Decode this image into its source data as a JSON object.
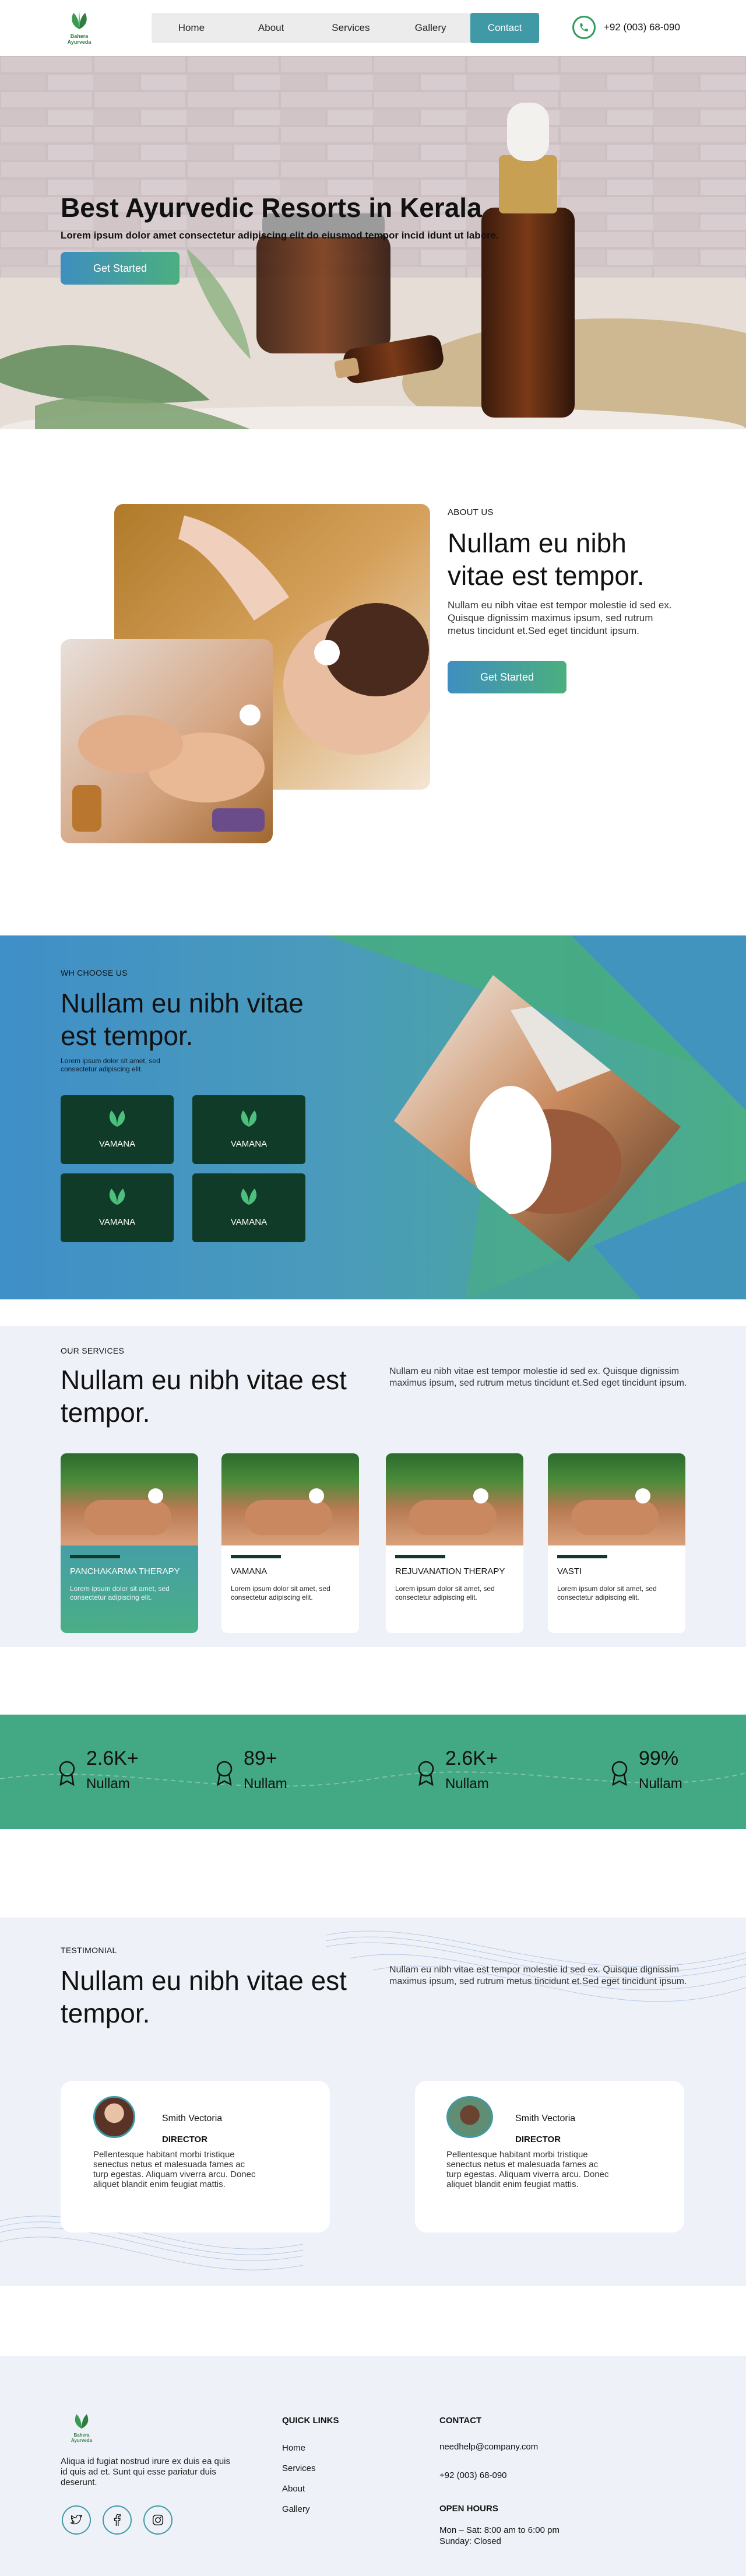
{
  "header": {
    "logo_text": "Bahera Ayurveda",
    "nav": [
      "Home",
      "About",
      "Services",
      "Gallery",
      "Contact"
    ],
    "phone": "+92 (003) 68-090"
  },
  "hero": {
    "title": "Best Ayurvedic Resorts in Kerala",
    "subtitle": "Lorem ipsum dolor amet consectetur adipiscing elit do eiusmod tempor incid idunt ut labore.",
    "cta": "Get Started"
  },
  "about": {
    "eyebrow": "ABOUT US",
    "title": "Nullam eu nibh vitae est tempor.",
    "text": "Nullam eu nibh vitae est tempor molestie id sed ex. Quisque dignissim maximus ipsum, sed rutrum metus tincidunt et.Sed eget tincidunt ipsum.",
    "cta": "Get Started"
  },
  "why": {
    "eyebrow": "WH CHOOSE US",
    "title": "Nullam eu nibh vitae est tempor.",
    "text": "Lorem ipsum dolor sit amet, sed consectetur adipiscing elit.",
    "cards": [
      "VAMANA",
      "VAMANA",
      "VAMANA",
      "VAMANA"
    ]
  },
  "services": {
    "eyebrow": "OUR SERVICES",
    "title": "Nullam eu nibh vitae est tempor.",
    "text": "Nullam eu nibh vitae est tempor molestie id sed ex. Quisque dignissim maximus ipsum, sed rutrum metus tincidunt et.Sed eget tincidunt ipsum.",
    "items": [
      {
        "name": "PANCHAKARMA THERAPY",
        "desc": "Lorem ipsum dolor sit amet, sed consectetur adipiscing elit."
      },
      {
        "name": "VAMANA",
        "desc": "Lorem ipsum dolor sit amet, sed consectetur adipiscing elit."
      },
      {
        "name": "REJUVANATION THERAPY",
        "desc": "Lorem ipsum dolor sit amet, sed consectetur adipiscing elit."
      },
      {
        "name": "VASTI",
        "desc": "Lorem ipsum dolor sit amet, sed consectetur adipiscing elit."
      }
    ]
  },
  "stats": [
    {
      "value": "2.6K+",
      "label": "Nullam"
    },
    {
      "value": "89+",
      "label": "Nullam"
    },
    {
      "value": "2.6K+",
      "label": "Nullam"
    },
    {
      "value": "99%",
      "label": "Nullam"
    }
  ],
  "testimonial": {
    "eyebrow": "TESTIMONIAL",
    "title": "Nullam eu nibh vitae est tempor.",
    "text": "Nullam eu nibh vitae est tempor molestie id sed ex. Quisque dignissim maximus ipsum, sed rutrum metus tincidunt et.Sed eget tincidunt ipsum.",
    "cards": [
      {
        "name": "Smith Vectoria",
        "role": "DIRECTOR",
        "quote": "Pellentesque habitant morbi tristique senectus netus et malesuada fames ac turp egestas. Aliquam viverra arcu. Donec aliquet blandit enim feugiat mattis."
      },
      {
        "name": "Smith Vectoria",
        "role": "DIRECTOR",
        "quote": "Pellentesque habitant morbi tristique senectus netus et malesuada fames ac turp egestas. Aliquam viverra arcu. Donec aliquet blandit enim feugiat mattis."
      }
    ]
  },
  "footer": {
    "about": "Aliqua id fugiat nostrud irure ex duis ea quis id quis ad et. Sunt qui esse pariatur duis deserunt.",
    "quick_links_title": "QUICK LINKS",
    "quick_links": [
      "Home",
      "Services",
      "About",
      "Gallery"
    ],
    "contact_title": "CONTACT",
    "email": "needhelp@company.com",
    "phone": "+92 (003) 68-090",
    "hours_title": "OPEN HOURS",
    "hours": [
      "Mon – Sat: 8:00 am to 6:00 pm",
      "Sunday: Closed"
    ]
  },
  "colors": {
    "accent": "#3f9aa6",
    "green": "#43a884",
    "dark_green": "#0f3b28",
    "blue": "#3f8fc8"
  }
}
